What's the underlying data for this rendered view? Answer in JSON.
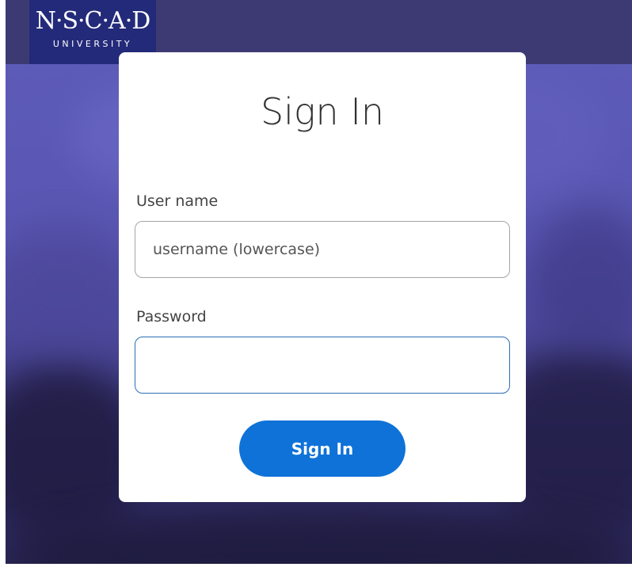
{
  "header": {
    "logo": {
      "main_text": "N·S·C·A·D",
      "sub_text": "UNIVERSITY"
    }
  },
  "signin_card": {
    "title": "Sign In",
    "username": {
      "label": "User name",
      "placeholder": "username (lowercase)",
      "value": ""
    },
    "password": {
      "label": "Password",
      "placeholder": "",
      "value": ""
    },
    "submit_label": "Sign In"
  },
  "colors": {
    "header_bar": "#3d3a73",
    "logo_background": "#242a7a",
    "background_overlay": "#5856b0",
    "primary_button": "#0f72d8",
    "focused_field_border": "#2b6fb2"
  }
}
